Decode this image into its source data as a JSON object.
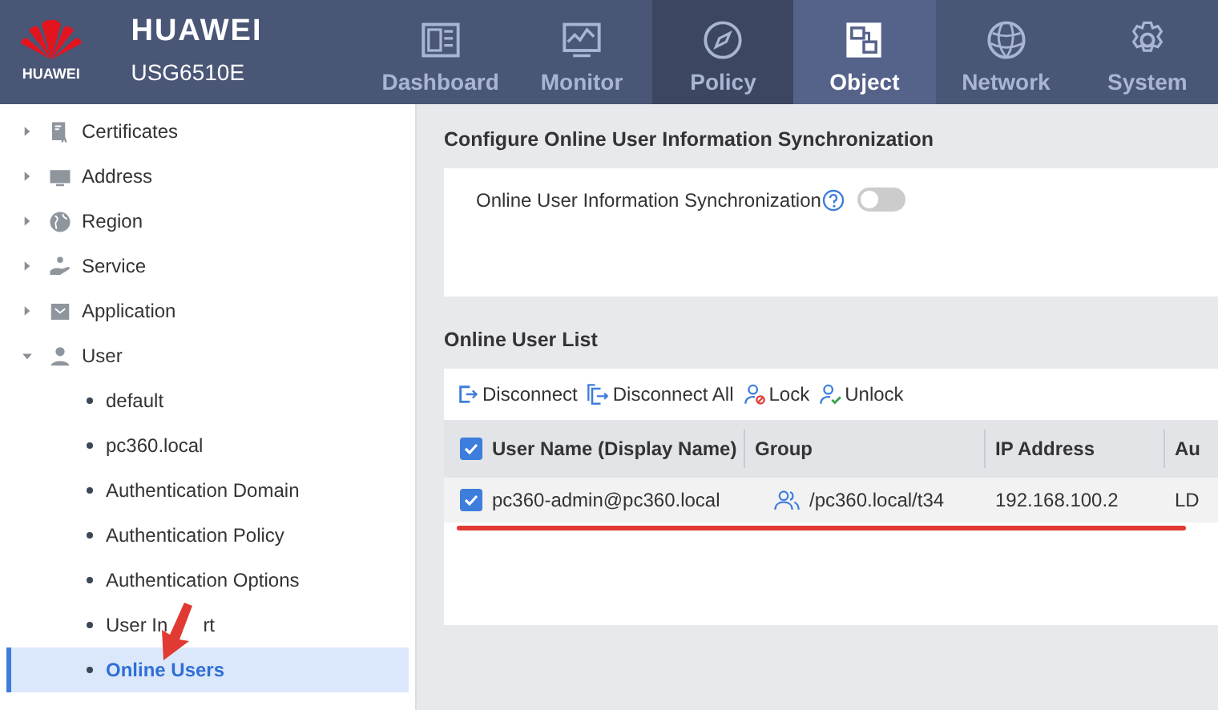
{
  "brand": {
    "logo_text": "HUAWEI",
    "name": "HUAWEI",
    "model": "USG6510E"
  },
  "nav_tabs": [
    {
      "label": "Dashboard",
      "selected": false,
      "hovered": false
    },
    {
      "label": "Monitor",
      "selected": false,
      "hovered": false
    },
    {
      "label": "Policy",
      "selected": false,
      "hovered": true
    },
    {
      "label": "Object",
      "selected": true,
      "hovered": false
    },
    {
      "label": "Network",
      "selected": false,
      "hovered": false
    },
    {
      "label": "System",
      "selected": false,
      "hovered": false
    }
  ],
  "sidebar": {
    "items": [
      {
        "label": "Certificates",
        "expanded": false
      },
      {
        "label": "Address",
        "expanded": false
      },
      {
        "label": "Region",
        "expanded": false
      },
      {
        "label": "Service",
        "expanded": false
      },
      {
        "label": "Application",
        "expanded": false
      },
      {
        "label": "User",
        "expanded": true,
        "children": [
          {
            "label": "default",
            "selected": false
          },
          {
            "label": "pc360.local",
            "selected": false
          },
          {
            "label": "Authentication Domain",
            "selected": false
          },
          {
            "label": "Authentication Policy",
            "selected": false
          },
          {
            "label": "Authentication Options",
            "selected": false
          },
          {
            "label": "User In",
            "label_end": "rt",
            "selected": false
          },
          {
            "label": "Online Users",
            "selected": true
          }
        ]
      }
    ]
  },
  "sync_section": {
    "title": "Configure Online User Information Synchronization",
    "label": "Online User Information Synchronization",
    "on": false
  },
  "list_section": {
    "title": "Online User List",
    "toolbar": [
      {
        "label": "Disconnect"
      },
      {
        "label": "Disconnect All"
      },
      {
        "label": "Lock"
      },
      {
        "label": "Unlock"
      }
    ],
    "table": {
      "all_checked": true,
      "columns": [
        "User Name (Display Name)",
        "Group",
        "IP Address",
        "Au"
      ],
      "rows": [
        {
          "checked": true,
          "cells": [
            "pc360-admin@pc360.local",
            "/pc360.local/t34",
            "192.168.100.2",
            "LD"
          ]
        }
      ]
    }
  },
  "annotations": {
    "underline": {
      "color": "#e03a32"
    },
    "arrow": {
      "color": "#e03a32"
    }
  }
}
